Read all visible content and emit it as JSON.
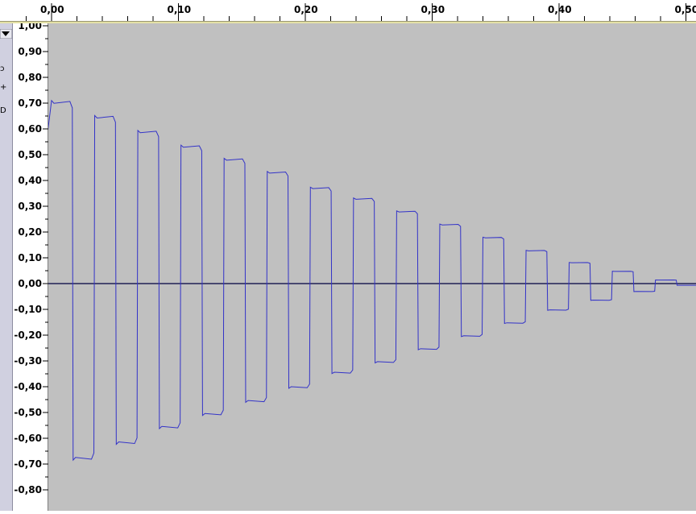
{
  "timeline": {
    "labels": [
      "0,00",
      "0,10",
      "0,20",
      "0,30",
      "0,40",
      "0,50"
    ]
  },
  "track_panel": {
    "menu_icon": "dropdown-triangle-icon",
    "glyphs": [
      "ɔ",
      "+",
      "D"
    ]
  },
  "amplitude_ruler": {
    "labels": [
      "1,00",
      "0,90",
      "0,80",
      "0,70",
      "0,60",
      "0,50",
      "0,40",
      "0,30",
      "0,20",
      "0,10",
      "0,00",
      "-0,10",
      "-0,20",
      "-0,30",
      "-0,40",
      "-0,50",
      "-0,60",
      "-0,70",
      "-0,80"
    ]
  },
  "colors": {
    "waveform": "#3232c8",
    "background": "#c0c0c0",
    "zero_line": "#000040"
  },
  "chart_data": {
    "type": "line",
    "title": "",
    "xlabel": "",
    "ylabel": "",
    "description_values": "decaying square wave, peak amplitude per cycle",
    "x": [
      0.0,
      0.02,
      0.04,
      0.06,
      0.08,
      0.1,
      0.12,
      0.14,
      0.16,
      0.18,
      0.2,
      0.22,
      0.24,
      0.26,
      0.28,
      0.3,
      0.32,
      0.34,
      0.36,
      0.38,
      0.4,
      0.42,
      0.44,
      0.46,
      0.48,
      0.5
    ],
    "series": [
      {
        "values": [
          0.71,
          0.68,
          0.64,
          0.61,
          0.57,
          0.54,
          0.51,
          0.48,
          0.45,
          0.42,
          0.38,
          0.35,
          0.33,
          0.3,
          0.27,
          0.24,
          0.21,
          0.18,
          0.15,
          0.12,
          0.09,
          0.07,
          0.05,
          0.03,
          0.01,
          0.005
        ]
      }
    ],
    "xlim": [
      0.0,
      0.51
    ],
    "ylim": [
      -0.88,
      1.0
    ],
    "grid": false
  }
}
